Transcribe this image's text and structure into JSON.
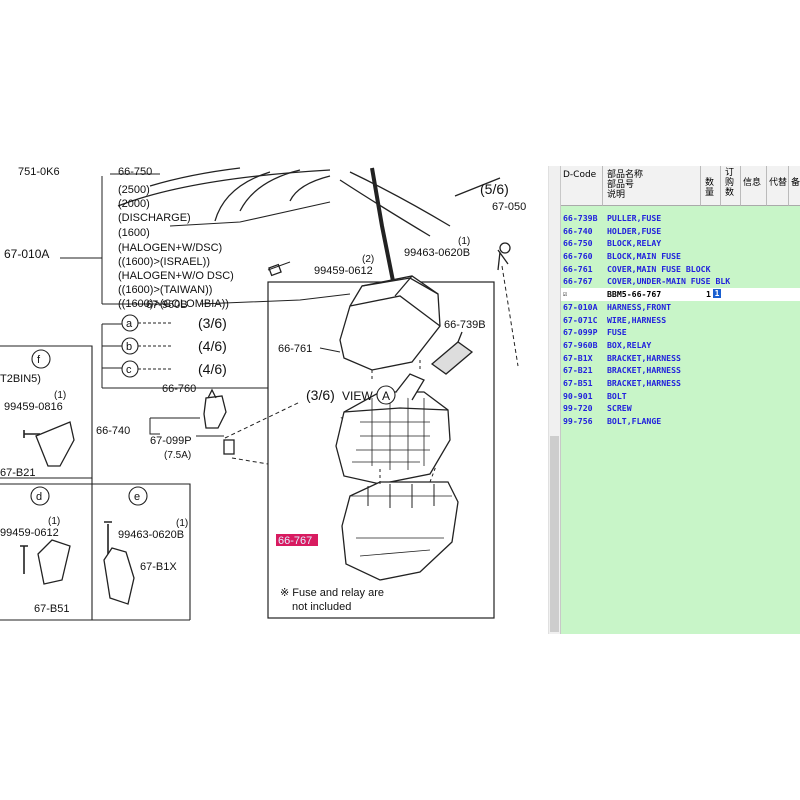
{
  "diagram": {
    "top_labels": [
      "751-0K6",
      "66-750",
      "(2500)",
      "(2000)",
      "(DISCHARGE)",
      "(1600)",
      "(HALOGEN+W/DSC)",
      "((1600)>(ISRAEL))",
      "(HALOGEN+W/O DSC)",
      "((1600)>(TAIWAN))",
      "((1600)>(COLOMBIA))"
    ],
    "part_67_010A": "67-010A",
    "part_67_960B": "67-960B",
    "part_66_760": "66-760",
    "ref_5_6": "(5/6)",
    "part_67_050": "67-050",
    "qty_1_a": "(1)",
    "bolt_99463_top": "99463-0620B",
    "qty_2": "(2)",
    "bolt_99459_top": "99459-0612",
    "circle_a": "a",
    "circle_b": "b",
    "circle_c": "c",
    "ref_3_6_a": "(3/6)",
    "ref_4_6_b": "(4/6)",
    "ref_4_6_c": "(4/6)",
    "part_66_761": "66-761",
    "part_66_739B": "66-739B",
    "ref_3_6_view": "(3/6)",
    "view_label": "VIEW",
    "view_circle": "A",
    "part_66_740": "66-740",
    "part_67_099P": "67-099P",
    "fuse_rating": "(7.5A)",
    "part_66_767": "66-767",
    "note_line1": "※ Fuse and relay are",
    "note_line2": "not included",
    "box_f": "f",
    "box_f_note": "T2BIN5)",
    "box_f_qty": "(1)",
    "box_f_bolt": "99459-0816",
    "box_f_part": "67-B21",
    "box_d": "d",
    "box_d_qty": "(1)",
    "box_d_bolt": "99459-0612",
    "box_d_part": "67-B51",
    "box_e": "e",
    "box_e_qty": "(1)",
    "box_e_bolt": "99463-0620B",
    "box_e_part": "67-B1X"
  },
  "parts_table": {
    "headers": {
      "dcode": "D-Code",
      "name_line1": "部品名称",
      "name_line2": "部品号",
      "name_line3": "说明",
      "qty_a": "数",
      "qty_b": "量",
      "order_a": "订",
      "order_b": "购",
      "order_c": "数",
      "info_a": "信",
      "info_b": "息",
      "sub_a": "代",
      "sub_b": "替",
      "extra": "备"
    },
    "rows": [
      {
        "code": "66-739B",
        "name": "PULLER,FUSE"
      },
      {
        "code": "66-740",
        "name": "HOLDER,FUSE"
      },
      {
        "code": "66-750",
        "name": "BLOCK,RELAY"
      },
      {
        "code": "66-760",
        "name": "BLOCK,MAIN FUSE"
      },
      {
        "code": "66-761",
        "name": "COVER,MAIN FUSE BLOCK"
      },
      {
        "code": "66-767",
        "name": "COVER,UNDER-MAIN FUSE BLK"
      }
    ],
    "selected_row": {
      "check": "☑",
      "part_no": "BBM5-66-767",
      "qty": "1",
      "order_qty": "1"
    },
    "rows2": [
      {
        "code": "67-010A",
        "name": "HARNESS,FRONT"
      },
      {
        "code": "67-071C",
        "name": "WIRE,HARNESS"
      },
      {
        "code": "67-099P",
        "name": "FUSE"
      },
      {
        "code": "67-960B",
        "name": "BOX,RELAY"
      },
      {
        "code": "67-B1X",
        "name": "BRACKET,HARNESS"
      },
      {
        "code": "67-B21",
        "name": "BRACKET,HARNESS"
      },
      {
        "code": "67-B51",
        "name": "BRACKET,HARNESS"
      },
      {
        "code": "90-901",
        "name": "BOLT"
      },
      {
        "code": "99-720",
        "name": "SCREW"
      },
      {
        "code": "99-756",
        "name": "BOLT,FLANGE"
      }
    ],
    "colors": {
      "background": "#c8f5c8",
      "text": "#2222dd",
      "highlight": "#d81b60"
    }
  }
}
